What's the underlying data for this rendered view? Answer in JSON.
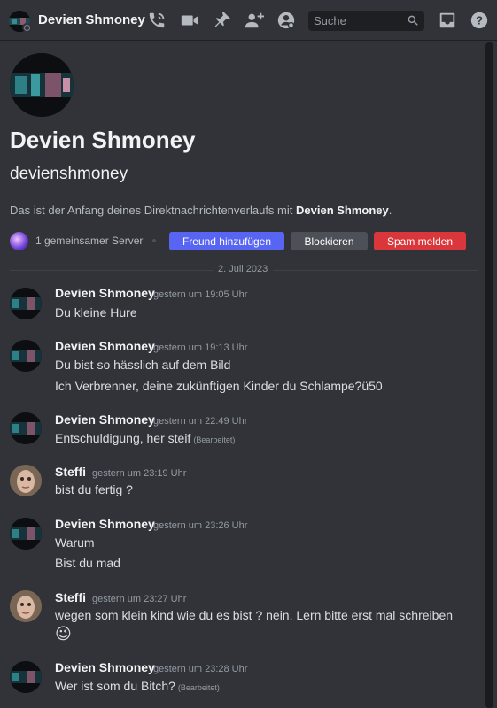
{
  "header": {
    "title": "Devien Shmoney",
    "search_placeholder": "Suche"
  },
  "profile": {
    "display_name": "Devien Shmoney",
    "username": "devienshmoney",
    "intro_prefix": "Das ist der Anfang deines Direktnachrichtenverlaufs mit ",
    "intro_name": "Devien Shmoney",
    "intro_suffix": ".",
    "mutual_servers": "1 gemeinsamer Server",
    "add_friend": "Freund hinzufügen",
    "block": "Blockieren",
    "report_spam": "Spam melden"
  },
  "date_divider": "2. Juli 2023",
  "messages": [
    {
      "author": "Devien Shmoney",
      "time": "gestern um 19:05 Uhr",
      "lines": [
        "Du kleine Hure"
      ]
    },
    {
      "author": "Devien Shmoney",
      "time": "gestern um 19:13 Uhr",
      "lines": [
        "Du bist so hässlich auf dem Bild",
        "Ich Verbrenner, deine zukünftigen Kinder du Schlampe?ü50"
      ]
    },
    {
      "author": "Devien Shmoney",
      "time": "gestern um 22:49 Uhr",
      "lines": [
        "Entschuldigung, her steif"
      ],
      "edited": "(Bearbeitet)"
    },
    {
      "author": "Steffi",
      "time": "gestern um 23:19 Uhr",
      "lines": [
        "bist du fertig ?"
      ]
    },
    {
      "author": "Devien Shmoney",
      "time": "gestern um 23:26 Uhr",
      "lines": [
        "Warum",
        "Bist du mad"
      ]
    },
    {
      "author": "Steffi",
      "time": "gestern um 23:27 Uhr",
      "lines": [
        "wegen som klein kind wie du es bist ? nein. Lern bitte erst mal schreiben"
      ],
      "emoji": "😉"
    },
    {
      "author": "Devien Shmoney",
      "time": "gestern um 23:28 Uhr",
      "lines": [
        "Wer ist som du Bitch?"
      ],
      "edited": "(Bearbeitet)"
    }
  ],
  "icons": [
    "call-icon",
    "video-icon",
    "pin-icon",
    "add-member-icon",
    "user-profile-icon",
    "search-icon",
    "inbox-icon",
    "help-icon"
  ],
  "colors": {
    "blurple": "#5865f2",
    "danger": "#da373c",
    "secondary": "#4e5058",
    "background": "#313338"
  }
}
